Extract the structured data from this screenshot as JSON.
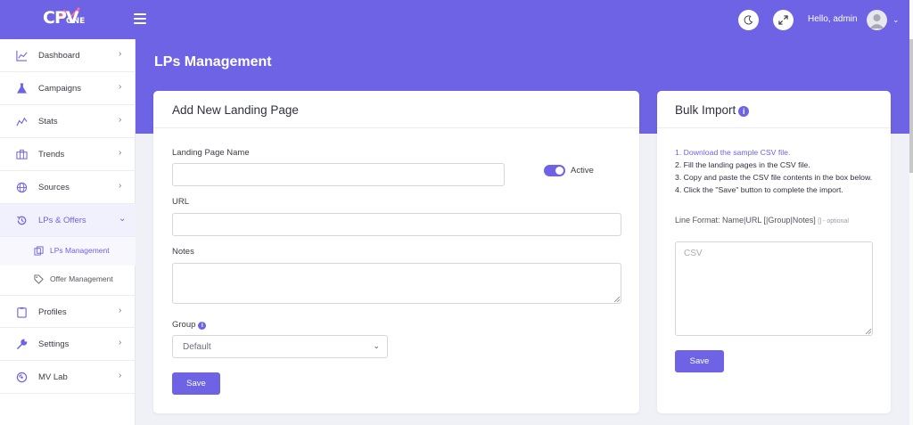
{
  "app": {
    "logo_text": "CPV",
    "logo_sub": "ONE",
    "greeting": "Hello, admin"
  },
  "icons": {
    "menu": "hamburger-icon",
    "theme": "moon-icon",
    "fullscreen": "expand-icon",
    "avatar": "user-avatar-icon"
  },
  "colors": {
    "accent": "#6d63e4",
    "background": "#f0f1f7"
  },
  "sidebar": {
    "items": [
      {
        "label": "Dashboard",
        "icon": "chart-line-icon"
      },
      {
        "label": "Campaigns",
        "icon": "flask-icon"
      },
      {
        "label": "Stats",
        "icon": "stats-icon"
      },
      {
        "label": "Trends",
        "icon": "trends-icon"
      },
      {
        "label": "Sources",
        "icon": "globe-icon"
      },
      {
        "label": "LPs & Offers",
        "icon": "history-icon",
        "expanded": true
      },
      {
        "label": "Profiles",
        "icon": "clipboard-icon"
      },
      {
        "label": "Settings",
        "icon": "wrench-icon"
      },
      {
        "label": "MV Lab",
        "icon": "lab-icon"
      }
    ],
    "subitems": [
      {
        "label": "LPs Management",
        "icon": "copy-icon",
        "active": true
      },
      {
        "label": "Offer Management",
        "icon": "tag-icon",
        "active": false
      }
    ]
  },
  "page": {
    "title": "LPs Management"
  },
  "add_form": {
    "title": "Add New Landing Page",
    "name_label": "Landing Page Name",
    "name_value": "",
    "active_label": "Active",
    "active": true,
    "url_label": "URL",
    "url_value": "",
    "notes_label": "Notes",
    "notes_value": "",
    "group_label": "Group",
    "group_info": "i",
    "group_selected": "Default",
    "save_label": "Save"
  },
  "bulk_import": {
    "title": "Bulk Import",
    "info": "i",
    "step1": "1. Download the sample CSV file.",
    "step2": "2. Fill the landing pages in the CSV file.",
    "step3": "3. Copy and paste the CSV file contents in the box below.",
    "step4": "4. Click the \"Save\" button to complete the import.",
    "line_format": "Line Format: Name|URL [|Group|Notes]",
    "optional_note": "[] - optional",
    "csv_placeholder": "CSV",
    "save_label": "Save"
  }
}
